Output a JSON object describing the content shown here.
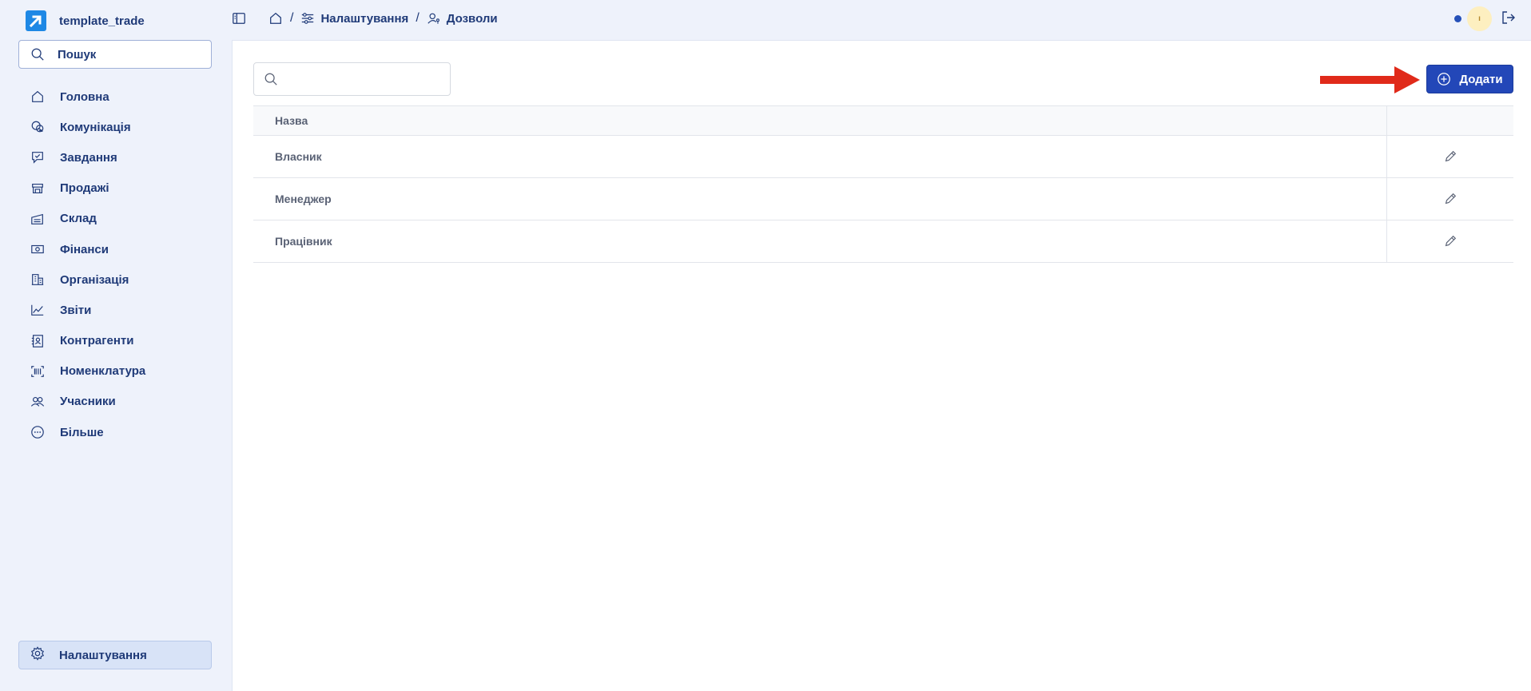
{
  "brand": {
    "name": "template_trade"
  },
  "sidebar": {
    "search_label": "Пошук",
    "items": [
      {
        "label": "Головна",
        "icon": "home-icon"
      },
      {
        "label": "Комунікація",
        "icon": "chat-icon"
      },
      {
        "label": "Завдання",
        "icon": "task-icon"
      },
      {
        "label": "Продажі",
        "icon": "store-icon"
      },
      {
        "label": "Склад",
        "icon": "warehouse-icon"
      },
      {
        "label": "Фінанси",
        "icon": "money-icon"
      },
      {
        "label": "Організація",
        "icon": "building-icon"
      },
      {
        "label": "Звіти",
        "icon": "chart-icon"
      },
      {
        "label": "Контрагенти",
        "icon": "contact-icon"
      },
      {
        "label": "Номенклатура",
        "icon": "barcode-icon"
      },
      {
        "label": "Учасники",
        "icon": "users-icon"
      },
      {
        "label": "Більше",
        "icon": "more-icon"
      }
    ],
    "settings_label": "Налаштування"
  },
  "breadcrumb": {
    "sep": "/",
    "settings": "Налаштування",
    "permissions": "Дозволи"
  },
  "header": {
    "avatar_initial": "ı",
    "status_color": "#2550b8"
  },
  "toolbar": {
    "add_label": "Додати",
    "search_value": ""
  },
  "table": {
    "columns": [
      "Назва",
      ""
    ],
    "rows": [
      {
        "name": "Власник"
      },
      {
        "name": "Менеджер"
      },
      {
        "name": "Працівник"
      }
    ]
  },
  "colors": {
    "accent": "#2347b8",
    "brand": "#1e88e5",
    "arrow": "#e02a1a"
  }
}
